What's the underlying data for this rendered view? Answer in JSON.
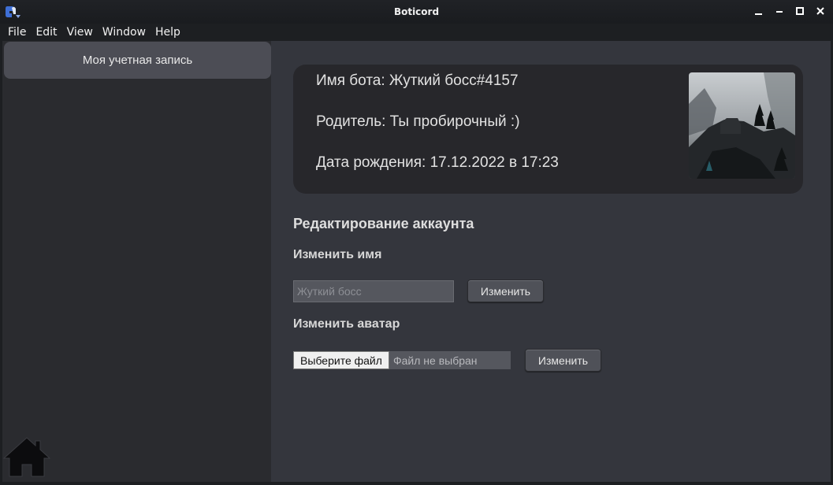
{
  "window": {
    "title": "Boticord",
    "controls": [
      "minimize",
      "restore",
      "maximize",
      "close"
    ]
  },
  "menu": [
    "File",
    "Edit",
    "View",
    "Window",
    "Help"
  ],
  "sidebar": {
    "items": [
      {
        "label": "Моя учетная запись",
        "selected": true
      }
    ],
    "home_icon": "home-icon"
  },
  "bot": {
    "name_line": "Имя бота: Жуткий босс#4157",
    "parent_line": "Родитель: Ты пробирочный :)",
    "birth_line": "Дата рождения: 17.12.2022 в 17:23"
  },
  "edit": {
    "title": "Редактирование аккаунта",
    "name_section": {
      "title": "Изменить имя",
      "input_placeholder": "Жуткий босс",
      "input_value": "",
      "button_label": "Изменить"
    },
    "avatar_section": {
      "title": "Изменить аватар",
      "choose_file_label": "Выберите файл",
      "file_status": "Файл не выбран",
      "button_label": "Изменить"
    }
  },
  "colors": {
    "sidebar_bg": "#2a2b2f",
    "main_bg": "#34363d",
    "card_bg": "#27272b",
    "selected_item_bg": "#4c4d55"
  }
}
